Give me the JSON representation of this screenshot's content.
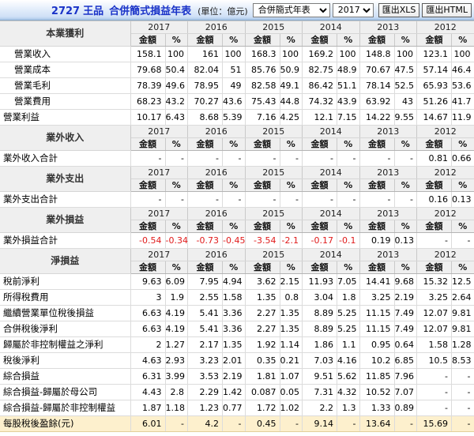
{
  "toolbar": {
    "stock_code": "2727",
    "stock_name": "王品",
    "report_title": "合併簡式損益年表",
    "unit": "(單位：億元)",
    "report_select_value": "合併簡式年表",
    "report_select_options": [
      "合併簡式年表"
    ],
    "year_select_value": "2017年",
    "year_select_options": [
      "2017年"
    ],
    "export_xls_label": "匯出XLS",
    "export_html_label": "匯出HTML"
  },
  "colors": {
    "title_blue": "#1a33c8",
    "section_blue": "#2222dd",
    "negative_red": "#e01b1b",
    "eps_row_bg": "#fdf0cd",
    "section_bg": "#efefef"
  },
  "years": [
    "2017",
    "2016",
    "2015",
    "2014",
    "2013",
    "2012"
  ],
  "subheaders": [
    "金額",
    "%"
  ],
  "sections": [
    {
      "name": "本業獲利",
      "rows": [
        {
          "label": "營業收入",
          "indent": true,
          "values": [
            "158.1",
            "100",
            "161",
            "100",
            "168.3",
            "100",
            "169.2",
            "100",
            "148.8",
            "100",
            "123.1",
            "100"
          ]
        },
        {
          "label": "營業成本",
          "indent": true,
          "values": [
            "79.68",
            "50.4",
            "82.04",
            "51",
            "85.76",
            "50.9",
            "82.75",
            "48.9",
            "70.67",
            "47.5",
            "57.14",
            "46.4"
          ]
        },
        {
          "label": "營業毛利",
          "indent": true,
          "values": [
            "78.39",
            "49.6",
            "78.95",
            "49",
            "82.58",
            "49.1",
            "86.42",
            "51.1",
            "78.14",
            "52.5",
            "65.93",
            "53.6"
          ]
        },
        {
          "label": "營業費用",
          "indent": true,
          "values": [
            "68.23",
            "43.2",
            "70.27",
            "43.6",
            "75.43",
            "44.8",
            "74.32",
            "43.9",
            "63.92",
            "43",
            "51.26",
            "41.7"
          ]
        },
        {
          "label": "營業利益",
          "indent": false,
          "values": [
            "10.17",
            "6.43",
            "8.68",
            "5.39",
            "7.16",
            "4.25",
            "12.1",
            "7.15",
            "14.22",
            "9.55",
            "14.67",
            "11.9"
          ]
        }
      ]
    },
    {
      "name": "業外收入",
      "rows": [
        {
          "label": "業外收入合計",
          "indent": false,
          "values": [
            "-",
            "-",
            "-",
            "-",
            "-",
            "-",
            "-",
            "-",
            "-",
            "-",
            "0.81",
            "0.66"
          ]
        }
      ]
    },
    {
      "name": "業外支出",
      "rows": [
        {
          "label": "業外支出合計",
          "indent": false,
          "values": [
            "-",
            "-",
            "-",
            "-",
            "-",
            "-",
            "-",
            "-",
            "-",
            "-",
            "0.16",
            "0.13"
          ]
        }
      ]
    },
    {
      "name": "業外損益",
      "rows": [
        {
          "label": "業外損益合計",
          "indent": false,
          "values": [
            "-0.54",
            "-0.34",
            "-0.73",
            "-0.45",
            "-3.54",
            "-2.1",
            "-0.17",
            "-0.1",
            "0.19",
            "0.13",
            "-",
            "-"
          ]
        }
      ]
    },
    {
      "name": "淨損益",
      "rows": [
        {
          "label": "稅前淨利",
          "indent": false,
          "values": [
            "9.63",
            "6.09",
            "7.95",
            "4.94",
            "3.62",
            "2.15",
            "11.93",
            "7.05",
            "14.41",
            "9.68",
            "15.32",
            "12.5"
          ]
        },
        {
          "label": "所得稅費用",
          "indent": false,
          "values": [
            "3",
            "1.9",
            "2.55",
            "1.58",
            "1.35",
            "0.8",
            "3.04",
            "1.8",
            "3.25",
            "2.19",
            "3.25",
            "2.64"
          ]
        },
        {
          "label": "繼續營業單位稅後損益",
          "indent": false,
          "values": [
            "6.63",
            "4.19",
            "5.41",
            "3.36",
            "2.27",
            "1.35",
            "8.89",
            "5.25",
            "11.15",
            "7.49",
            "12.07",
            "9.81"
          ]
        },
        {
          "label": "合併稅後淨利",
          "indent": false,
          "values": [
            "6.63",
            "4.19",
            "5.41",
            "3.36",
            "2.27",
            "1.35",
            "8.89",
            "5.25",
            "11.15",
            "7.49",
            "12.07",
            "9.81"
          ]
        },
        {
          "label": "歸屬於非控制權益之淨利",
          "indent": false,
          "values": [
            "2",
            "1.27",
            "2.17",
            "1.35",
            "1.92",
            "1.14",
            "1.86",
            "1.1",
            "0.95",
            "0.64",
            "1.58",
            "1.28"
          ]
        },
        {
          "label": "稅後淨利",
          "indent": false,
          "values": [
            "4.63",
            "2.93",
            "3.23",
            "2.01",
            "0.35",
            "0.21",
            "7.03",
            "4.16",
            "10.2",
            "6.85",
            "10.5",
            "8.53"
          ]
        },
        {
          "label": "綜合損益",
          "indent": false,
          "values": [
            "6.31",
            "3.99",
            "3.53",
            "2.19",
            "1.81",
            "1.07",
            "9.51",
            "5.62",
            "11.85",
            "7.96",
            "-",
            "-"
          ]
        },
        {
          "label": "綜合損益-歸屬於母公司",
          "indent": false,
          "values": [
            "4.43",
            "2.8",
            "2.29",
            "1.42",
            "0.087",
            "0.05",
            "7.31",
            "4.32",
            "10.52",
            "7.07",
            "-",
            "-"
          ]
        },
        {
          "label": "綜合損益-歸屬於非控制權益",
          "indent": false,
          "values": [
            "1.87",
            "1.18",
            "1.23",
            "0.77",
            "1.72",
            "1.02",
            "2.2",
            "1.3",
            "1.33",
            "0.89",
            "-",
            "-"
          ]
        },
        {
          "label": "每股稅後盈餘(元)",
          "indent": false,
          "eps": true,
          "values": [
            "6.01",
            "-",
            "4.2",
            "-",
            "0.45",
            "-",
            "9.14",
            "-",
            "13.64",
            "-",
            "15.69",
            "-"
          ]
        }
      ]
    }
  ]
}
